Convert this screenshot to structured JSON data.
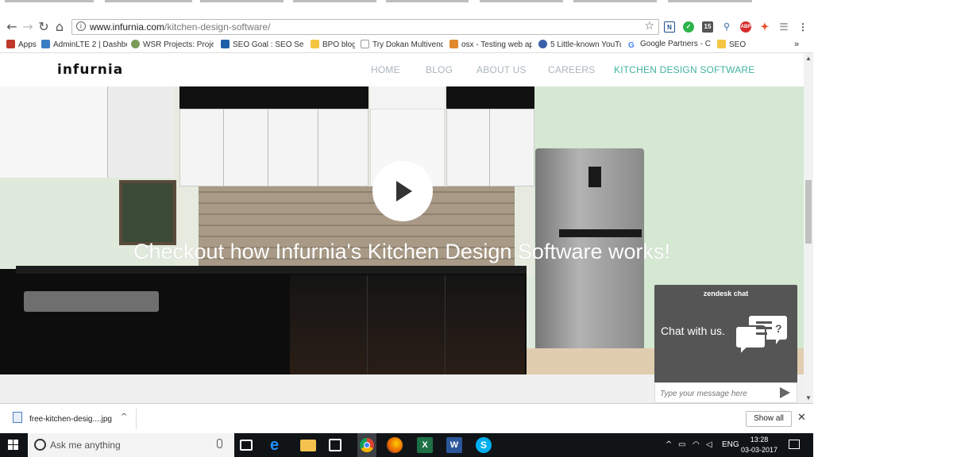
{
  "browser": {
    "url_host": "www.infurnia.com",
    "url_path": "/kitchen-design-software/",
    "extensions": [
      {
        "name": "n-icon",
        "label": "N",
        "color": "#1e4e8c"
      },
      {
        "name": "check-icon",
        "label": "",
        "color": "#2eb24a"
      },
      {
        "name": "calendar-icon",
        "label": "15",
        "color": "#555555"
      },
      {
        "name": "link-icon",
        "label": "",
        "color": "#6c8fbf"
      },
      {
        "name": "adblock-icon",
        "label": "ABP",
        "color": "#d62d2d"
      },
      {
        "name": "puzzle-icon",
        "label": "",
        "color": "#e8542c"
      }
    ]
  },
  "bookmarks": {
    "items": [
      {
        "label": "Apps",
        "icon": "apps-icon",
        "color": "#c0392b"
      },
      {
        "label": "AdminLTE 2 | Dashbo",
        "icon": "power-icon",
        "color": "#3b7dc4"
      },
      {
        "label": "WSR Projects: Project",
        "icon": "cloud-icon",
        "color": "#7a9a5a"
      },
      {
        "label": "SEO Goal : SEO Servic",
        "icon": "seo-icon",
        "color": "#1f5fa8"
      },
      {
        "label": "BPO blog",
        "icon": "folder-icon",
        "color": "#f4c542"
      },
      {
        "label": "Try Dokan Multivendo",
        "icon": "page-icon",
        "color": "#999999"
      },
      {
        "label": "osx - Testing web app",
        "icon": "stack-icon",
        "color": "#e08a2c"
      },
      {
        "label": "5 Little-known YouTu",
        "icon": "search-page-icon",
        "color": "#3b5ea8"
      },
      {
        "label": "Google Partners - Cer",
        "icon": "google-icon",
        "color": "#4285f4"
      },
      {
        "label": "SEO",
        "icon": "folder-icon",
        "color": "#f4c542"
      }
    ],
    "overflow": "»"
  },
  "site": {
    "logo": "infurnia",
    "nav": [
      {
        "label": "HOME",
        "active": false
      },
      {
        "label": "BLOG",
        "active": false
      },
      {
        "label": "ABOUT US",
        "active": false
      },
      {
        "label": "CAREERS",
        "active": false
      },
      {
        "label": "KITCHEN DESIGN SOFTWARE",
        "active": true
      }
    ],
    "hero_caption": "Checkout how Infurnia's Kitchen Design Software works!",
    "accent_color": "#3fb3a0"
  },
  "chat": {
    "brand": "zendesk chat",
    "title": "Chat with us.",
    "placeholder": "Type your message here"
  },
  "download": {
    "file_name": "free-kitchen-desig....jpg",
    "show_all": "Show all"
  },
  "taskbar": {
    "search_placeholder": "Ask me anything",
    "language": "ENG",
    "time": "13:28",
    "date": "03-03-2017"
  }
}
